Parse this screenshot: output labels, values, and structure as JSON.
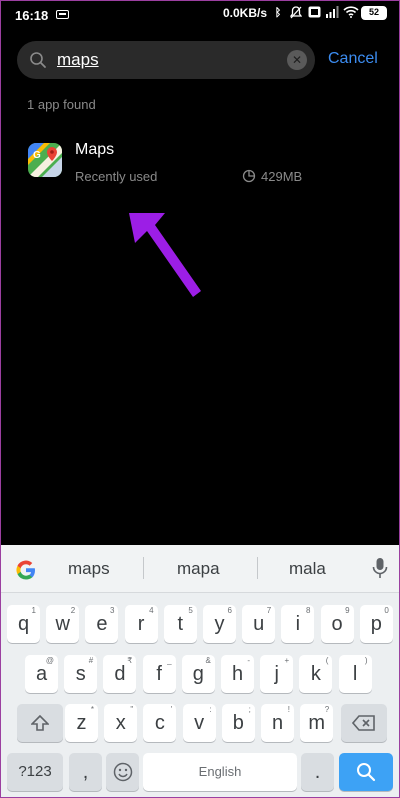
{
  "status_bar": {
    "time": "16:18",
    "net_speed": "0.0KB/s",
    "battery": "52"
  },
  "search": {
    "query": "maps",
    "cancel_label": "Cancel"
  },
  "results": {
    "count_text": "1 app found",
    "items": [
      {
        "name": "Maps",
        "subtitle": "Recently used",
        "size": "429MB"
      }
    ]
  },
  "annotation": {
    "arrow_color": "#9c1ee6"
  },
  "keyboard": {
    "suggestions": [
      "maps",
      "mapa",
      "mala"
    ],
    "row1": [
      {
        "label": "q",
        "hint": "1"
      },
      {
        "label": "w",
        "hint": "2"
      },
      {
        "label": "e",
        "hint": "3"
      },
      {
        "label": "r",
        "hint": "4"
      },
      {
        "label": "t",
        "hint": "5"
      },
      {
        "label": "y",
        "hint": "6"
      },
      {
        "label": "u",
        "hint": "7"
      },
      {
        "label": "i",
        "hint": "8"
      },
      {
        "label": "o",
        "hint": "9"
      },
      {
        "label": "p",
        "hint": "0"
      }
    ],
    "row2": [
      {
        "label": "a",
        "hint": "@"
      },
      {
        "label": "s",
        "hint": "#"
      },
      {
        "label": "d",
        "hint": "₹"
      },
      {
        "label": "f",
        "hint": "_"
      },
      {
        "label": "g",
        "hint": "&"
      },
      {
        "label": "h",
        "hint": "-"
      },
      {
        "label": "j",
        "hint": "+"
      },
      {
        "label": "k",
        "hint": "("
      },
      {
        "label": "l",
        "hint": ")"
      }
    ],
    "row3": [
      {
        "label": "z",
        "hint": "*"
      },
      {
        "label": "x",
        "hint": "\""
      },
      {
        "label": "c",
        "hint": "'"
      },
      {
        "label": "v",
        "hint": ":"
      },
      {
        "label": "b",
        "hint": ";"
      },
      {
        "label": "n",
        "hint": "!"
      },
      {
        "label": "m",
        "hint": "?"
      }
    ],
    "symbols_label": "?123",
    "comma_label": ",",
    "space_label": "English",
    "period_label": "."
  }
}
